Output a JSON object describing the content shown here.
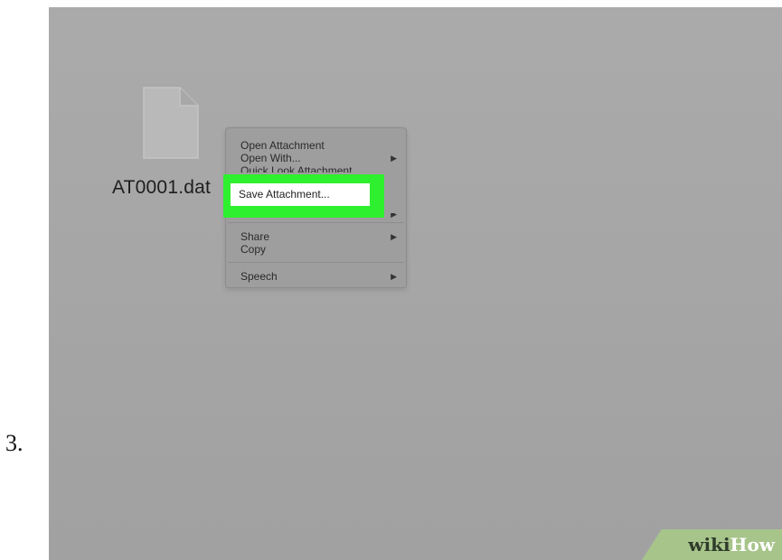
{
  "step": {
    "number": "3."
  },
  "desktop": {
    "file": {
      "icon": "document-icon",
      "label": "AT0001.dat"
    }
  },
  "context_menu": {
    "items": [
      {
        "label": "Open Attachment",
        "has_submenu": false
      },
      {
        "label": "Open With...",
        "has_submenu": true
      },
      {
        "label": "Quick Look Attachment",
        "has_submenu": false
      },
      {
        "label": "Save Attachment...",
        "has_submenu": true,
        "highlighted": true
      },
      {
        "label": "Share",
        "has_submenu": true
      },
      {
        "label": "Copy",
        "has_submenu": false
      },
      {
        "label": "Speech",
        "has_submenu": true
      }
    ],
    "submenu_arrow": "▶"
  },
  "highlight": {
    "color": "#2ff02f"
  },
  "watermark": {
    "wiki": "wiki",
    "how": "How",
    "color": "#a7c48b"
  }
}
